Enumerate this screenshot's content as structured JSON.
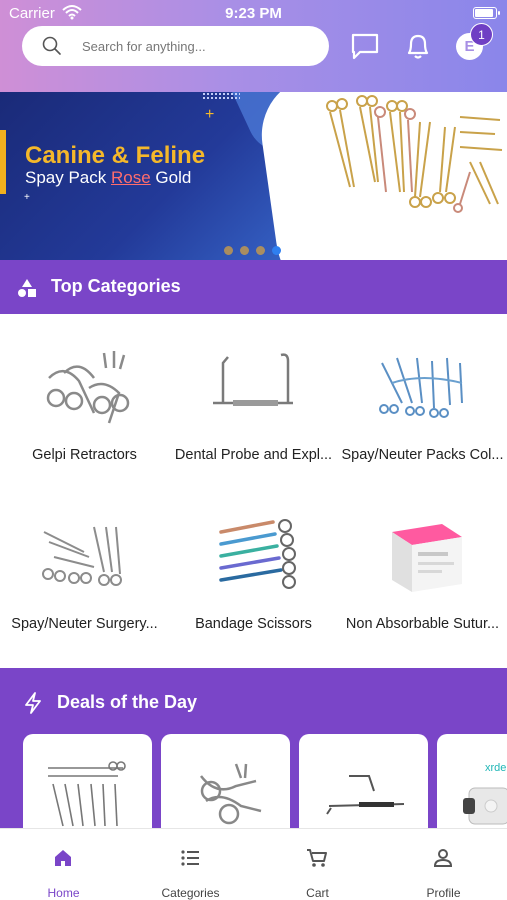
{
  "status_bar": {
    "carrier": "Carrier",
    "time": "9:23 PM"
  },
  "header": {
    "search_placeholder": "Search for anything...",
    "avatar_initial": "E",
    "notification_count": "1",
    "icons": [
      "search-icon",
      "chat-icon",
      "bell-icon"
    ]
  },
  "banner": {
    "headline": "Canine & Feline",
    "sub_prefix": "Spay Pack ",
    "sub_highlight": "Rose",
    "sub_suffix": " Gold",
    "slides": 4,
    "active_slide": 4
  },
  "top_categories": {
    "title": "Top Categories",
    "items": [
      {
        "label": "Gelpi Retractors"
      },
      {
        "label": "Dental Probe and Expl..."
      },
      {
        "label": "Spay/Neuter Packs Col..."
      },
      {
        "label": "Spay/Neuter Surgery..."
      },
      {
        "label": "Bandage Scissors"
      },
      {
        "label": "Non Absorbable Sutur..."
      }
    ]
  },
  "deals": {
    "title": "Deals of the Day",
    "partial_card_text": "xrde"
  },
  "bottom_nav": {
    "items": [
      {
        "label": "Home",
        "icon": "home-icon",
        "active": true
      },
      {
        "label": "Categories",
        "icon": "list-icon",
        "active": false
      },
      {
        "label": "Cart",
        "icon": "cart-icon",
        "active": false
      },
      {
        "label": "Profile",
        "icon": "person-icon",
        "active": false
      }
    ]
  },
  "colors": {
    "primary": "#7a45c8",
    "banner_gold": "#f5b82a",
    "banner_blue": "#233a99"
  }
}
